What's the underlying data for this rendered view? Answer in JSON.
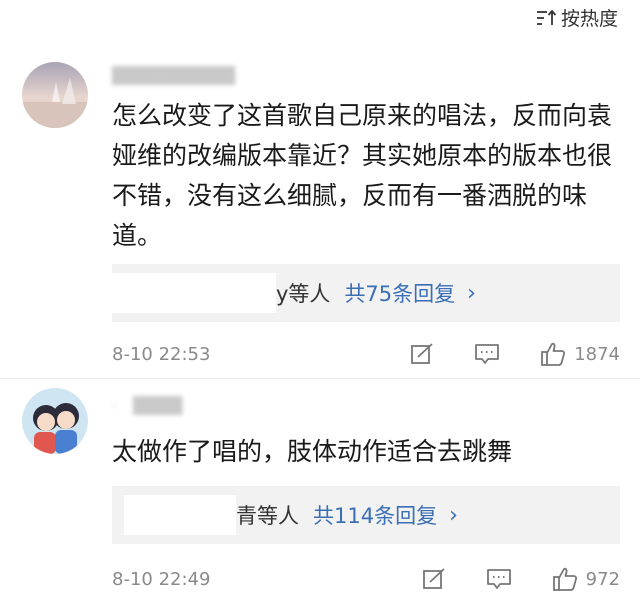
{
  "sort": {
    "label": "按热度"
  },
  "comments": [
    {
      "username": "",
      "text": "怎么改变了这首歌自己原来的唱法，反而向袁娅维的改编版本靠近？其实她原本的版本也很不错，没有这么细腻，反而有一番洒脱的味道。",
      "reply_names": "y等人",
      "reply_count": "共75条回复",
      "time": "8-10 22:53",
      "likes": "1874"
    },
    {
      "username": "",
      "text": "太做作了唱的，肢体动作适合去跳舞",
      "reply_names": "青等人",
      "reply_count": "共114条回复",
      "time": "8-10 22:49",
      "likes": "972"
    }
  ],
  "colors": {
    "link": "#3a6fb5",
    "meta": "#8a8a8a",
    "reply_bg": "#f2f2f2"
  },
  "icons": [
    "sort-icon",
    "edit-icon",
    "comment-icon",
    "like-icon",
    "chevron-right-icon"
  ]
}
